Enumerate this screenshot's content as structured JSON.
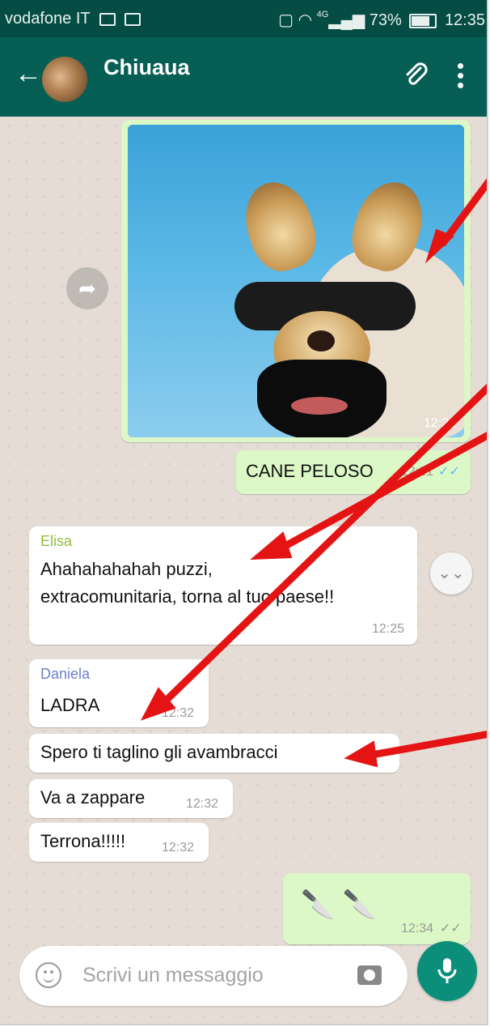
{
  "status_bar": {
    "carrier": "vodafone IT",
    "network": "4G",
    "battery": "73%",
    "clock": "12:35"
  },
  "header": {
    "contact_name": "Chiuaua"
  },
  "messages": {
    "photo_time": "12:21",
    "caption": "CANE PELOSO",
    "caption_time": "12:21",
    "elisa_sender": "Elisa",
    "elisa_text_1": "Ahahahahahah puzzi,",
    "elisa_text_2": "extracomunitaria, torna al tuo paese!!",
    "elisa_time": "12:25",
    "daniela_sender": "Daniela",
    "daniela_text": "LADRA",
    "daniela_time": "12:32",
    "m2_text": "Spero ti taglino gli avambracci",
    "m3_text": "Va a zappare",
    "m3_time": "12:32",
    "m4_text": "Terrona!!!!!",
    "m4_time": "12:32",
    "knives_text": "🔪 🔪",
    "knives_time": "12:34"
  },
  "input": {
    "placeholder": "Scrivi un messaggio"
  },
  "colors": {
    "header": "#075e54",
    "statusbar": "#054d44",
    "outgoing_bubble": "#dcf8c6",
    "incoming_bubble": "#ffffff",
    "elisa_name": "#8fbf3a",
    "daniela_name": "#6f7fc9",
    "mic_button": "#0b8f7a",
    "annotation_arrow": "#e41414"
  }
}
